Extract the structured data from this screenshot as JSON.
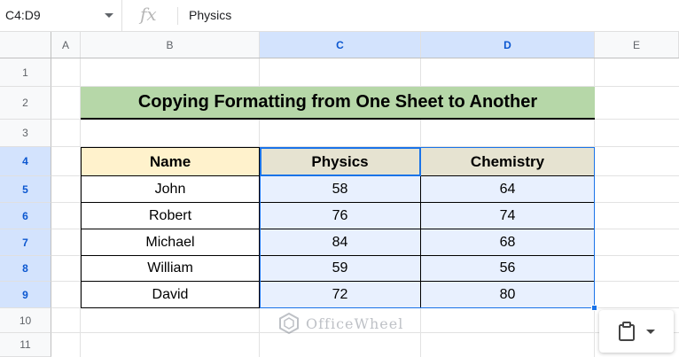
{
  "formula_bar": {
    "name_box": "C4:D9",
    "fx_label": "fx",
    "content": "Physics"
  },
  "columns": [
    "A",
    "B",
    "C",
    "D",
    "E"
  ],
  "rows": [
    "1",
    "2",
    "3",
    "4",
    "5",
    "6",
    "7",
    "8",
    "9",
    "10",
    "11"
  ],
  "title": "Copying Formatting from One Sheet to Another",
  "table": {
    "headers": [
      "Name",
      "Physics",
      "Chemistry"
    ],
    "rows": [
      [
        "John",
        "58",
        "64"
      ],
      [
        "Robert",
        "76",
        "74"
      ],
      [
        "Michael",
        "84",
        "68"
      ],
      [
        "William",
        "59",
        "56"
      ],
      [
        "David",
        "72",
        "80"
      ]
    ]
  },
  "watermark": {
    "text": "OfficeWheel"
  },
  "paste_chip": {
    "icon": "clipboard-icon"
  },
  "colors": {
    "title_fill": "#b6d7a8",
    "name_header_fill": "#fff2cc",
    "subject_header_fill": "#e6e3d1",
    "selection_fill": "#e8f0fe",
    "selection_border": "#1a73e8"
  }
}
